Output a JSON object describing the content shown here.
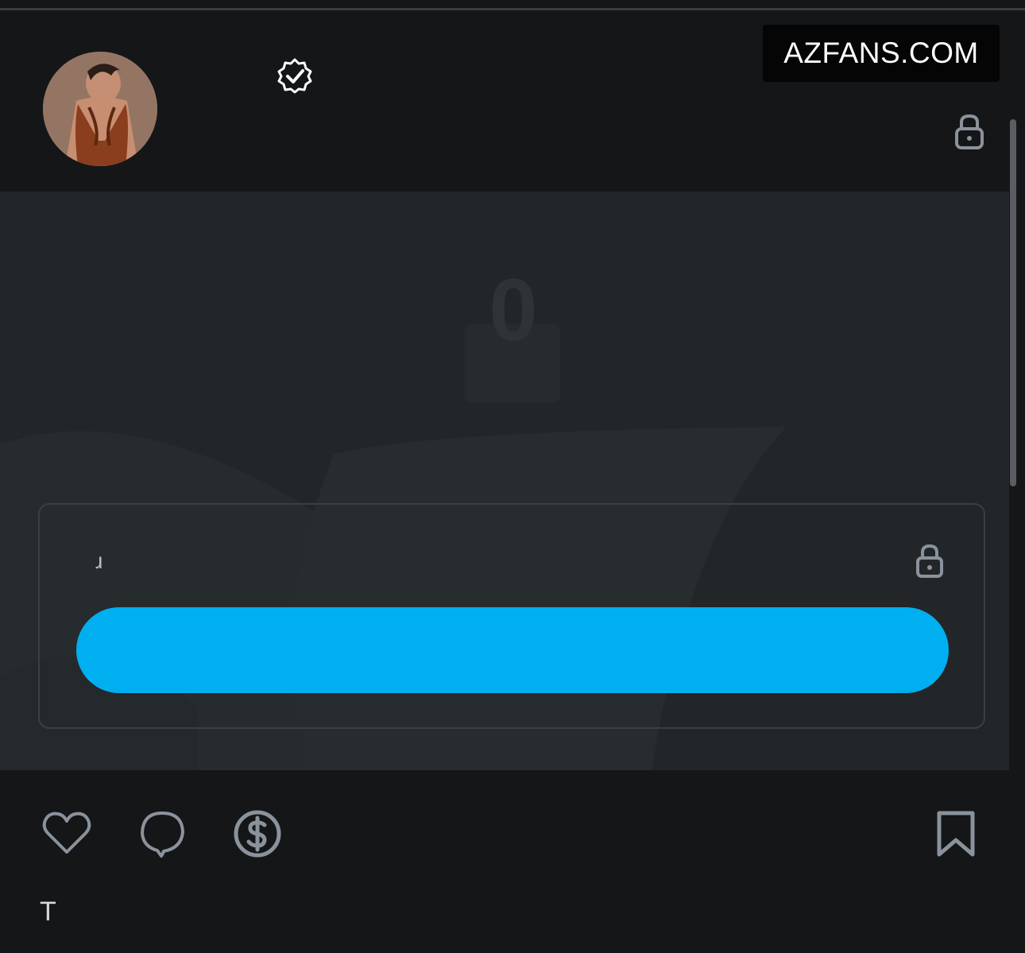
{
  "watermark": {
    "text": "AZFANS.COM"
  },
  "header": {
    "avatar_icon": "avatar",
    "verified_icon": "verified-badge-icon",
    "lock_icon": "lock-icon"
  },
  "media": {
    "count": "0"
  },
  "unlock_card": {
    "stat": "ɹ",
    "lock_icon": "lock-icon",
    "button_label": ""
  },
  "actions": {
    "like_icon": "heart-icon",
    "comment_icon": "comment-icon",
    "tip_icon": "dollar-icon",
    "bookmark_icon": "bookmark-icon"
  },
  "caption": {
    "text": "T"
  },
  "colors": {
    "background": "#151618",
    "media": "#222628",
    "accent": "#00aff0",
    "icon": "#8a939c"
  }
}
